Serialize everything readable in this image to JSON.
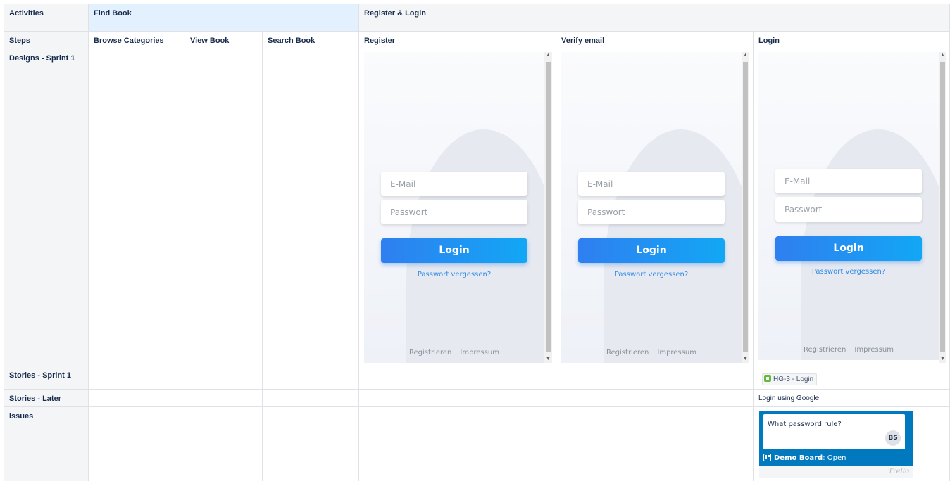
{
  "activities": {
    "label": "Activities",
    "items": [
      "Find Book",
      "Register & Login"
    ]
  },
  "steps": {
    "label": "Steps",
    "items": [
      "Browse Categories",
      "View Book",
      "Search Book",
      "Register",
      "Verify email",
      "Login"
    ]
  },
  "rows": {
    "designs": "Designs - Sprint 1",
    "stories_sprint": "Stories - Sprint 1",
    "stories_later": "Stories - Later",
    "issues": "Issues"
  },
  "mockup": {
    "email_placeholder": "E-Mail",
    "password_placeholder": "Passwort",
    "login_button": "Login",
    "forgot_link": "Passwort vergessen?",
    "register_link": "Registrieren",
    "imprint_link": "Impressum"
  },
  "stories": {
    "sprint1_login": "HG-3 - Login",
    "later_login": "Login using Google"
  },
  "issue_card": {
    "title": "What password rule?",
    "avatar": "BS",
    "board_name": "Demo Board",
    "board_status": ": Open",
    "logo": "Trello"
  },
  "colors": {
    "activity_blue": "#e3f0fd",
    "row_header": "#f4f5f7",
    "login_button": "#2f7ff0",
    "trello_blue": "#0079bf",
    "story_icon": "#63ba3c"
  }
}
